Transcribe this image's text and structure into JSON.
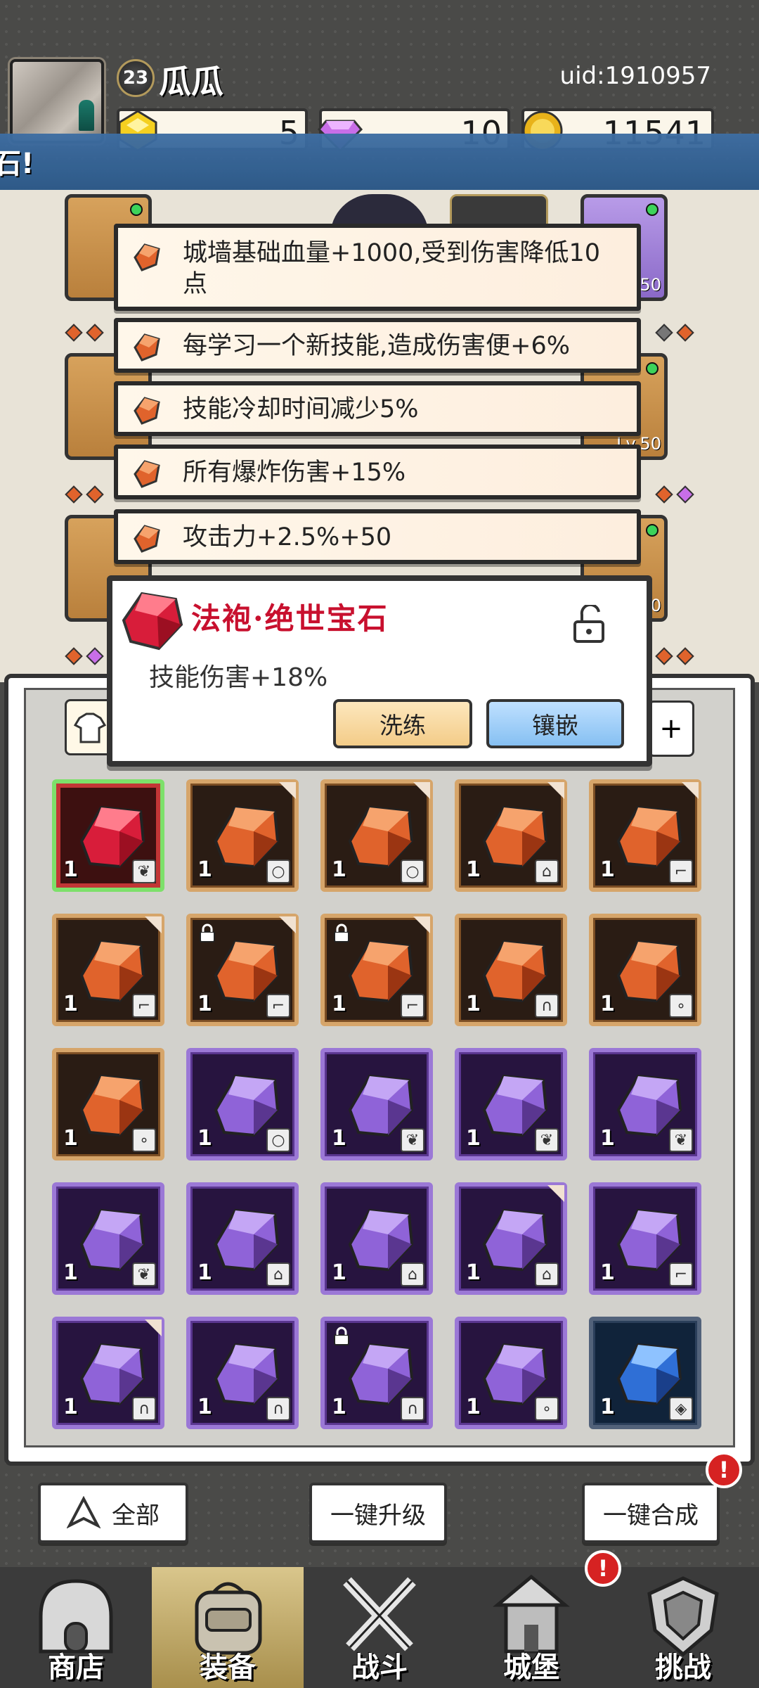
{
  "header": {
    "level": "23",
    "player_name": "瓜瓜",
    "uid": "uid:1910957",
    "currencies": [
      {
        "icon": "gold-crystal-icon",
        "value": "5"
      },
      {
        "icon": "purple-gem-icon",
        "value": "10"
      },
      {
        "icon": "gold-coin-icon",
        "value": "11541"
      }
    ],
    "banner_text": "石!"
  },
  "equipment": {
    "slots": [
      {
        "name": "equip-slot-top-left",
        "level": ""
      },
      {
        "name": "equip-slot-top-right",
        "level": "Lv.50"
      },
      {
        "name": "equip-slot-mid-left",
        "level": ""
      },
      {
        "name": "equip-slot-mid-right",
        "level": "Lv.50"
      },
      {
        "name": "equip-slot-bottom-left",
        "level": ""
      },
      {
        "name": "equip-slot-bottom-right",
        "level": "Lv.50"
      }
    ]
  },
  "buffs": [
    "城墙基础血量+1000,受到伤害降低10点",
    "每学习一个新技能,造成伤害便+6%",
    "技能冷却时间减少5%",
    "所有爆炸伤害+15%",
    "攻击力+2.5%+50"
  ],
  "popup": {
    "title": "法袍·绝世宝石",
    "description": "技能伤害+18%",
    "refine_label": "洗练",
    "inlay_label": "镶嵌"
  },
  "inventory": {
    "tab_plus": "+",
    "items": [
      {
        "color": "red",
        "count": "1",
        "type": "robe",
        "corner": false,
        "locked": false,
        "selected": true
      },
      {
        "color": "orange",
        "count": "1",
        "type": "ring",
        "corner": true,
        "locked": false
      },
      {
        "color": "orange",
        "count": "1",
        "type": "ring",
        "corner": true,
        "locked": false
      },
      {
        "color": "orange",
        "count": "1",
        "type": "boot",
        "corner": true,
        "locked": false
      },
      {
        "color": "orange",
        "count": "1",
        "type": "staff",
        "corner": true,
        "locked": false
      },
      {
        "color": "orange",
        "count": "1",
        "type": "staff",
        "corner": true,
        "locked": false
      },
      {
        "color": "orange",
        "count": "1",
        "type": "staff",
        "corner": true,
        "locked": true
      },
      {
        "color": "orange",
        "count": "1",
        "type": "staff",
        "corner": true,
        "locked": true
      },
      {
        "color": "orange",
        "count": "1",
        "type": "hat",
        "corner": false,
        "locked": false
      },
      {
        "color": "orange",
        "count": "1",
        "type": "necklace",
        "corner": false,
        "locked": false
      },
      {
        "color": "orange",
        "count": "1",
        "type": "necklace",
        "corner": false,
        "locked": false
      },
      {
        "color": "purple",
        "count": "1",
        "type": "ring",
        "corner": false,
        "locked": false
      },
      {
        "color": "purple",
        "count": "1",
        "type": "robe",
        "corner": false,
        "locked": false
      },
      {
        "color": "purple",
        "count": "1",
        "type": "robe",
        "corner": false,
        "locked": false
      },
      {
        "color": "purple",
        "count": "1",
        "type": "robe",
        "corner": false,
        "locked": false
      },
      {
        "color": "purple",
        "count": "1",
        "type": "robe",
        "corner": false,
        "locked": false
      },
      {
        "color": "purple",
        "count": "1",
        "type": "boot",
        "corner": false,
        "locked": false
      },
      {
        "color": "purple",
        "count": "1",
        "type": "boot",
        "corner": false,
        "locked": false
      },
      {
        "color": "purple",
        "count": "1",
        "type": "boot",
        "corner": true,
        "locked": false
      },
      {
        "color": "purple",
        "count": "1",
        "type": "staff",
        "corner": false,
        "locked": false
      },
      {
        "color": "purple",
        "count": "1",
        "type": "hat",
        "corner": true,
        "locked": false
      },
      {
        "color": "purple",
        "count": "1",
        "type": "hat",
        "corner": false,
        "locked": false
      },
      {
        "color": "purple",
        "count": "1",
        "type": "hat",
        "corner": false,
        "locked": true
      },
      {
        "color": "purple",
        "count": "1",
        "type": "necklace",
        "corner": false,
        "locked": false
      },
      {
        "color": "blue",
        "count": "1",
        "type": "shield",
        "corner": false,
        "locked": false
      }
    ]
  },
  "actions": {
    "filter_label": "全部",
    "upgrade_all_label": "一键升级",
    "merge_all_label": "一键合成",
    "alert": "!"
  },
  "nav": {
    "items": [
      {
        "label": "商店",
        "icon": "shop-icon"
      },
      {
        "label": "装备",
        "icon": "backpack-icon"
      },
      {
        "label": "战斗",
        "icon": "crossed-swords-icon"
      },
      {
        "label": "城堡",
        "icon": "castle-icon"
      },
      {
        "label": "挑战",
        "icon": "crest-shield-icon"
      }
    ],
    "alert": "!"
  },
  "colors": {
    "orange_gem": "#e0632c",
    "purple_gem": "#8f63d8",
    "red_gem": "#d81d3a",
    "blue_gem": "#2f6fd6",
    "banner_blue": "#3e6ea3"
  }
}
